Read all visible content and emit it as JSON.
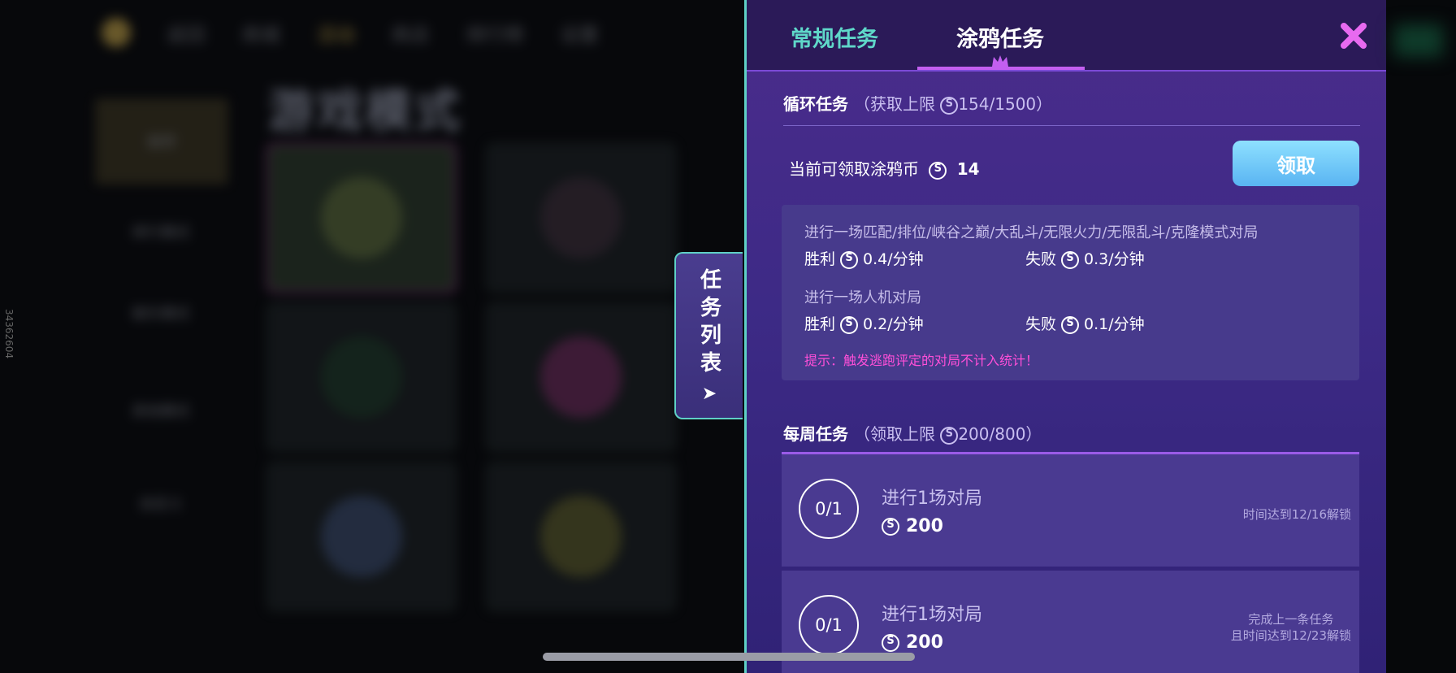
{
  "background": {
    "nav": [
      "返回",
      "商城",
      "活动",
      "商店",
      "排行榜",
      "设置"
    ],
    "title": "游戏模式",
    "sidebar": [
      "推荐",
      "排行模式",
      "娱乐模式",
      "其他模式",
      "自定义"
    ]
  },
  "side_tab": {
    "label": "任务列表"
  },
  "tabs": {
    "normal": "常规任务",
    "graffiti": "涂鸦任务",
    "active": "graffiti"
  },
  "cycle": {
    "title": "循环任务",
    "limit_label": "获取上限",
    "limit_value": "154/1500",
    "claimable_label": "当前可领取涂鸦币",
    "claimable_value": "14",
    "claim_button": "领取",
    "rule1": "进行一场匹配/排位/峡谷之巅/大乱斗/无限火力/无限乱斗/克隆模式对局",
    "rule1_win_label": "胜利",
    "rule1_win_rate": "0.4/分钟",
    "rule1_lose_label": "失败",
    "rule1_lose_rate": "0.3/分钟",
    "rule2": "进行一场人机对局",
    "rule2_win_label": "胜利",
    "rule2_win_rate": "0.2/分钟",
    "rule2_lose_label": "失败",
    "rule2_lose_rate": "0.1/分钟",
    "tip": "提示：触发逃跑评定的对局不计入统计！"
  },
  "weekly": {
    "title": "每周任务",
    "limit_label": "领取上限",
    "limit_value": "200/800",
    "tasks": [
      {
        "progress": "0/1",
        "name": "进行1场对局",
        "reward": "200",
        "status_line1": "时间达到12/16解锁",
        "status_line2": ""
      },
      {
        "progress": "0/1",
        "name": "进行1场对局",
        "reward": "200",
        "status_line1": "完成上一条任务",
        "status_line2": "且时间达到12/23解锁"
      }
    ]
  },
  "watermark": "34362604",
  "colors": {
    "accent_teal": "#5fd8c9",
    "accent_purple": "#c35ff0",
    "tip_pink": "#ff4fd8",
    "button_blue": "#59b4f2"
  }
}
